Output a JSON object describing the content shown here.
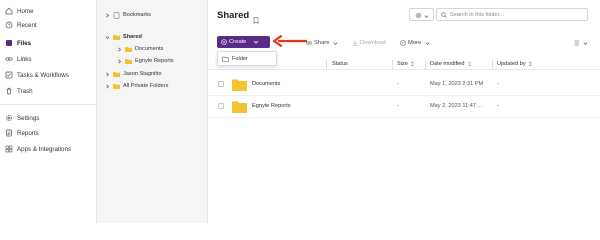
{
  "nav": {
    "items": [
      {
        "label": "Home",
        "icon": "home-icon"
      },
      {
        "label": "Recent",
        "icon": "clock-icon"
      },
      {
        "label": "Files",
        "icon": "files-icon",
        "active": true
      },
      {
        "label": "Links",
        "icon": "link-icon"
      },
      {
        "label": "Tasks & Workflows",
        "icon": "tasks-icon"
      },
      {
        "label": "Trash",
        "icon": "trash-icon"
      },
      {
        "label": "Settings",
        "icon": "gear-icon"
      },
      {
        "label": "Reports",
        "icon": "reports-icon"
      },
      {
        "label": "Apps & Integrations",
        "icon": "apps-icon"
      }
    ]
  },
  "tree": {
    "bookmarks": "Bookmarks",
    "shared": "Shared",
    "documents": "Documents",
    "egnyte_reports": "Egnyte Reports",
    "jason": "Jason Stagnitto",
    "private": "All Private Folders"
  },
  "main": {
    "title": "Shared",
    "search_placeholder": "Search in this folder...",
    "toolbar": {
      "create": "Create",
      "share": "Share",
      "download": "Download",
      "more": "More"
    },
    "create_menu": {
      "folder": "Folder"
    },
    "columns": {
      "status": "Status",
      "size": "Size",
      "date_modified": "Date modified",
      "updated_by": "Updated by"
    },
    "rows": [
      {
        "name": "Documents",
        "size": "-",
        "date": "May 1, 2023 2:31 PM",
        "updated_by": "-"
      },
      {
        "name": "Egnyte Reports",
        "size": "-",
        "date": "May 2, 2023 11:47 ...",
        "updated_by": "-"
      }
    ]
  },
  "colors": {
    "accent": "#5b2a86",
    "folder": "#f4c430",
    "arrow": "#e8341c"
  }
}
